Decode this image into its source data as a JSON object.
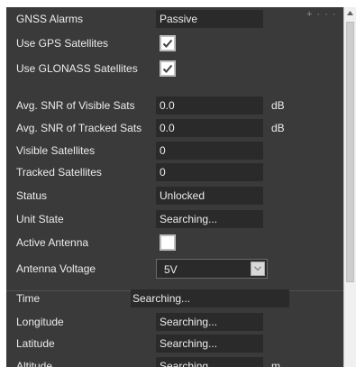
{
  "panel": {
    "more_label": "+ · · ·"
  },
  "rows": {
    "gnss_alarms": {
      "label": "GNSS Alarms",
      "value": "Passive"
    },
    "use_gps": {
      "label": "Use GPS Satellites",
      "checked": true
    },
    "use_glonass": {
      "label": "Use GLONASS Satellites",
      "checked": true
    },
    "avg_snr_visible": {
      "label": "Avg. SNR of Visible Sats",
      "value": "0.0",
      "unit": "dB"
    },
    "avg_snr_tracked": {
      "label": "Avg. SNR of Tracked Sats",
      "value": "0.0",
      "unit": "dB"
    },
    "visible_sats": {
      "label": "Visible Satellites",
      "value": "0"
    },
    "tracked_sats": {
      "label": "Tracked Satellites",
      "value": "0"
    },
    "status": {
      "label": "Status",
      "value": "Unlocked"
    },
    "unit_state": {
      "label": "Unit State",
      "value": "Searching..."
    },
    "active_antenna": {
      "label": "Active Antenna",
      "checked": false
    },
    "antenna_voltage": {
      "label": "Antenna Voltage",
      "value": "5V"
    },
    "time": {
      "label": "Time",
      "value": "Searching..."
    },
    "longitude": {
      "label": "Longitude",
      "value": "Searching..."
    },
    "latitude": {
      "label": "Latitude",
      "value": "Searching..."
    },
    "altitude": {
      "label": "Altitude",
      "value": "Searching...",
      "unit": "m"
    }
  },
  "colors": {
    "panel_bg": "#3a3a3a",
    "field_bg": "#2a2a2a",
    "text": "#ececec",
    "checkbox_bg": "#ffffff",
    "scrollbar_bg": "#f0f0f0"
  },
  "icons": {
    "checkmark": "check-icon",
    "dropdown": "chevron-down-icon",
    "more": "more-icon",
    "scroll_up": "arrow-up-icon"
  }
}
